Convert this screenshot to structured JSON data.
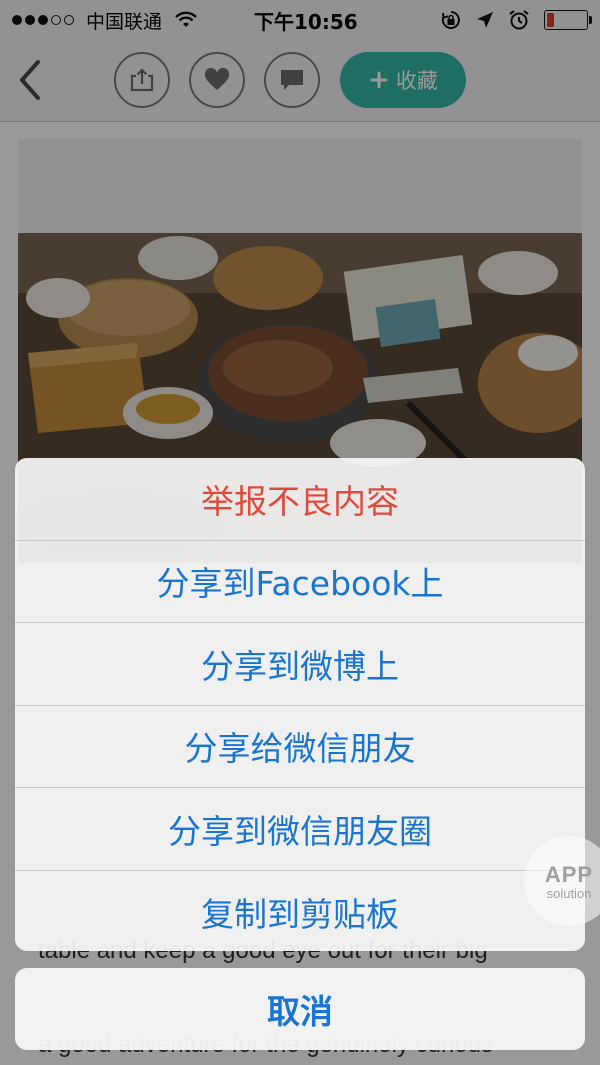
{
  "status_bar": {
    "carrier": "中国联通",
    "time": "下午10:56",
    "signal_filled": 3,
    "signal_total": 5,
    "battery_level": 0.18,
    "battery_color": "#e23b2e"
  },
  "nav": {
    "back_icon": "chevron-left-icon",
    "share_icon": "share-icon",
    "like_icon": "heart-icon",
    "comment_icon": "comment-icon",
    "collect_label": "收藏",
    "accent_color": "#33b8a7"
  },
  "article": {
    "text_line_1": "table and keep a good eye out for their big",
    "text_line_2": "a good adventure for the genuinely curious"
  },
  "action_sheet": {
    "items": [
      {
        "label": "举报不良内容"
      },
      {
        "label": "分享到Facebook上"
      },
      {
        "label": "分享到微博上"
      },
      {
        "label": "分享给微信朋友"
      },
      {
        "label": "分享到微信朋友圈"
      },
      {
        "label": "复制到剪贴板"
      }
    ],
    "cancel_label": "取消",
    "action_color": "#1a74d1",
    "destructive_color": "#e04a3c"
  },
  "watermark": {
    "line1": "APP",
    "line2": "solution"
  }
}
